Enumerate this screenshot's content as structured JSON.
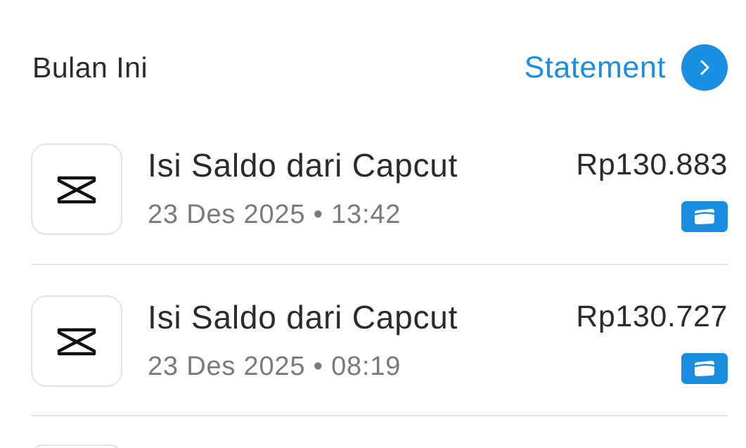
{
  "header": {
    "section_title": "Bulan Ini",
    "statement_label": "Statement"
  },
  "transactions": [
    {
      "title": "Isi Saldo dari Capcut",
      "datetime": "23 Des 2025 • 13:42",
      "amount": "Rp130.883",
      "app_icon": "capcut-icon",
      "badge_icon": "wallet-icon"
    },
    {
      "title": "Isi Saldo dari Capcut",
      "datetime": "23 Des 2025 • 08:19",
      "amount": "Rp130.727",
      "app_icon": "capcut-icon",
      "badge_icon": "wallet-icon"
    }
  ],
  "colors": {
    "accent": "#1a8ee0",
    "text_primary": "#2b2b2b",
    "text_secondary": "#7a7a7a",
    "divider": "#e4e4e4"
  }
}
